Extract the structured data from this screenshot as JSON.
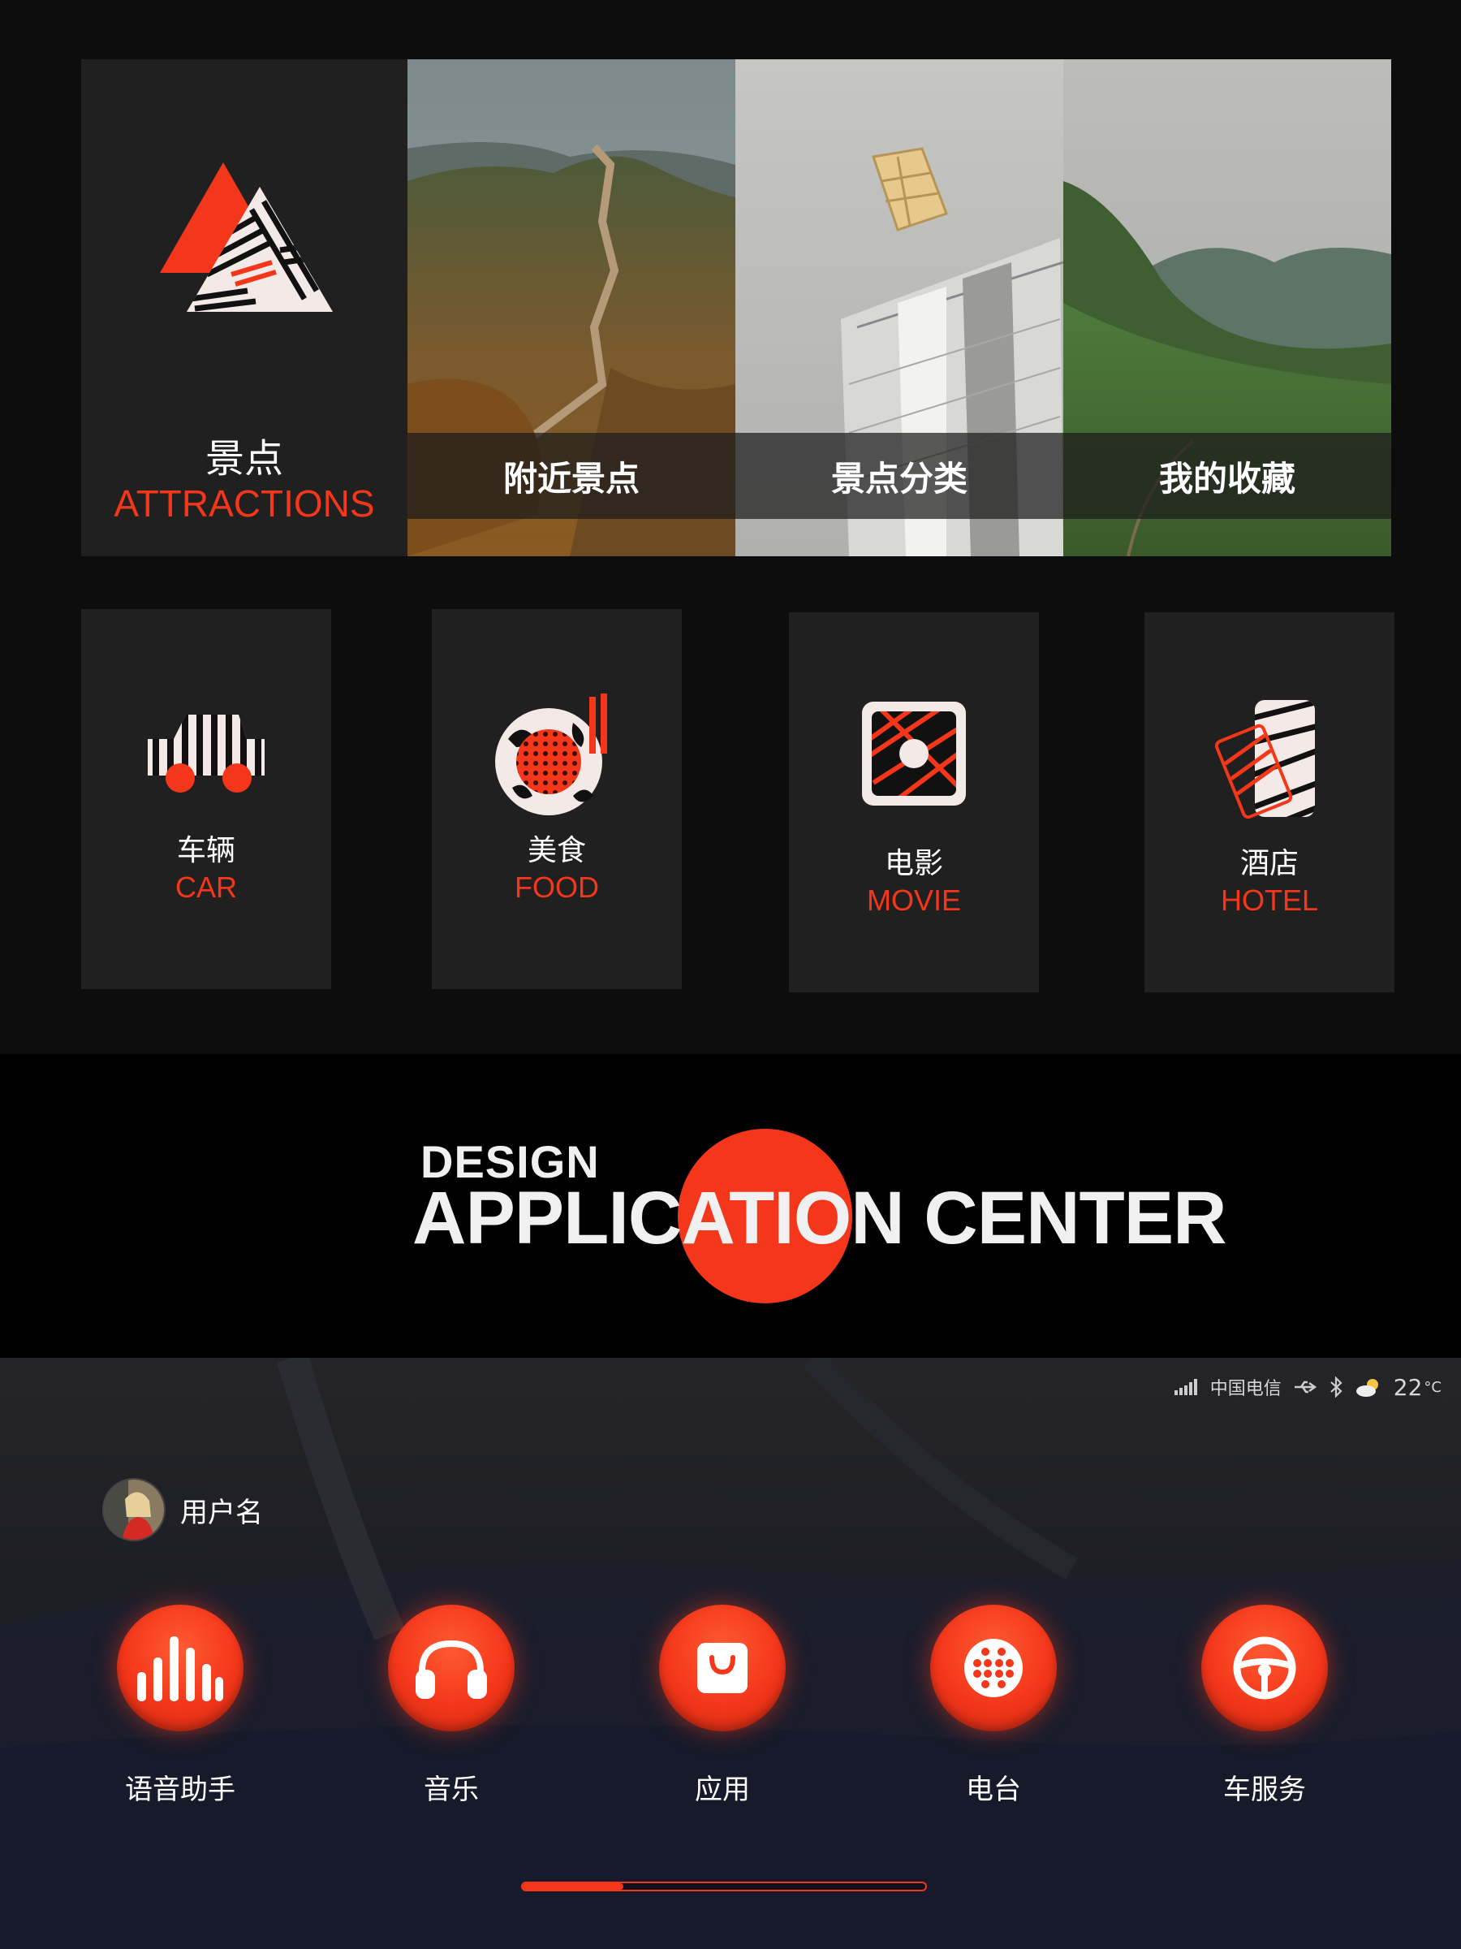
{
  "colors": {
    "accent": "#f4361a",
    "card": "#202020",
    "background": "#0d0d0e"
  },
  "attractions": {
    "title_cn": "景点",
    "title_en": "ATTRACTIONS",
    "icon": "attractions-triangle-icon"
  },
  "photo_tiles": [
    {
      "label": "附近景点",
      "image": "great-wall-photo"
    },
    {
      "label": "景点分类",
      "image": "tower-building-photo"
    },
    {
      "label": "我的收藏",
      "image": "green-valley-photo"
    }
  ],
  "categories": [
    {
      "cn": "车辆",
      "en": "CAR",
      "icon": "car-icon"
    },
    {
      "cn": "美食",
      "en": "FOOD",
      "icon": "food-plate-icon"
    },
    {
      "cn": "电影",
      "en": "MOVIE",
      "icon": "movie-icon"
    },
    {
      "cn": "酒店",
      "en": "HOTEL",
      "icon": "hotel-card-icon"
    }
  ],
  "banner": {
    "small": "DESIGN",
    "title": "APPLICATION CENTER"
  },
  "status_bar": {
    "carrier": "中国电信",
    "temperature": "22",
    "unit": "°C",
    "icons": [
      "signal-icon",
      "usb-icon",
      "bluetooth-icon",
      "weather-icon"
    ]
  },
  "user": {
    "name": "用户名"
  },
  "apps": [
    {
      "label": "语音助手",
      "icon": "voice-assistant-icon"
    },
    {
      "label": "音乐",
      "icon": "headphones-icon"
    },
    {
      "label": "应用",
      "icon": "bag-icon"
    },
    {
      "label": "电台",
      "icon": "radio-icon"
    },
    {
      "label": "车服务",
      "icon": "steering-wheel-icon"
    }
  ],
  "pager": {
    "progress": 0.25
  }
}
